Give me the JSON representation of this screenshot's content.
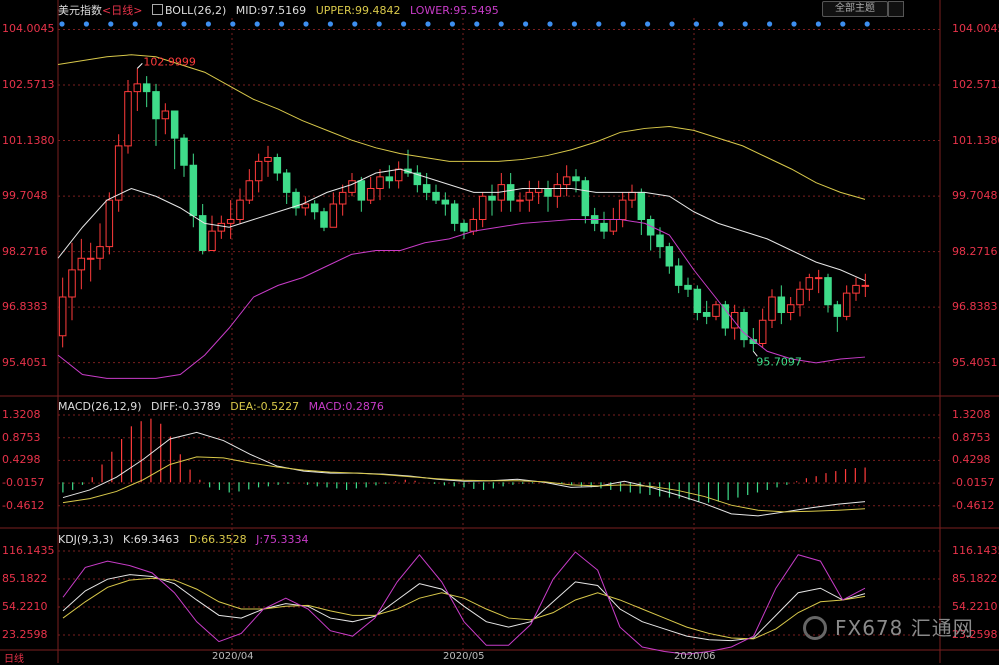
{
  "header": {
    "main": {
      "symbol": "美元指数",
      "period": "<日线>",
      "indicator": "BOLL(26,2)",
      "mid": "MID:97.5169",
      "upper": "UPPER:99.4842",
      "lower": "LOWER:95.5495"
    },
    "macd": {
      "name": "MACD(26,12,9)",
      "diff": "DIFF:-0.3789",
      "dea": "DEA:-0.5227",
      "macd": "MACD:0.2876"
    },
    "kdj": {
      "name": "KDJ(9,3,3)",
      "k": "K:69.3463",
      "d": "D:66.3528",
      "j": "J:75.3334"
    },
    "theme_button": "全部主题"
  },
  "colors": {
    "up": "#ff3b3b",
    "down": "#3fdc8a",
    "upper": "#d8c84a",
    "mid": "#e6e6e6",
    "lower": "#c83cc8",
    "dea": "#d8c84a",
    "diff": "#e6e6e6",
    "j": "#c83cc8",
    "grid": "#7a1f1f",
    "axis": "#e8334a"
  },
  "corner_label": "日线",
  "watermark": "FX678 汇通网",
  "chart_data": [
    {
      "type": "candlestick",
      "title": "美元指数 <日线> BOLL(26,2)",
      "ylim": [
        94.7,
        104.3
      ],
      "yticks": [
        104.0045,
        102.5713,
        101.138,
        99.7048,
        98.2716,
        96.8383,
        95.4051
      ],
      "xticks": [
        "2020/04",
        "2020/05",
        "2020/06"
      ],
      "annotations": [
        {
          "text": "102.9999",
          "type": "high"
        },
        {
          "text": "95.7097",
          "type": "low"
        }
      ],
      "candles": [
        [
          96.1,
          97.1,
          95.8,
          97.6
        ],
        [
          97.1,
          97.8,
          96.5,
          98.5
        ],
        [
          97.8,
          98.1,
          97.3,
          98.6
        ],
        [
          98.1,
          98.1,
          97.5,
          98.5
        ],
        [
          98.1,
          98.4,
          97.8,
          99.0
        ],
        [
          98.4,
          99.6,
          98.2,
          99.8
        ],
        [
          99.6,
          101.0,
          99.3,
          101.3
        ],
        [
          101.0,
          102.4,
          100.8,
          102.7
        ],
        [
          102.4,
          102.6,
          101.9,
          103.0
        ],
        [
          102.6,
          102.4,
          102.0,
          102.8
        ],
        [
          102.4,
          101.7,
          101.0,
          102.6
        ],
        [
          101.7,
          101.9,
          101.3,
          102.1
        ],
        [
          101.9,
          101.2,
          100.4,
          101.9
        ],
        [
          101.2,
          100.5,
          100.2,
          101.3
        ],
        [
          100.5,
          99.2,
          98.9,
          100.8
        ],
        [
          99.2,
          98.3,
          98.2,
          99.5
        ],
        [
          98.3,
          98.8,
          98.3,
          99.2
        ],
        [
          98.8,
          99.0,
          98.6,
          99.2
        ],
        [
          99.0,
          99.1,
          98.6,
          99.6
        ],
        [
          99.1,
          99.6,
          99.0,
          99.9
        ],
        [
          99.6,
          100.1,
          99.5,
          100.4
        ],
        [
          100.1,
          100.6,
          99.8,
          100.8
        ],
        [
          100.6,
          100.7,
          100.2,
          101.0
        ],
        [
          100.7,
          100.3,
          100.1,
          100.8
        ],
        [
          100.3,
          99.8,
          99.5,
          100.4
        ],
        [
          99.8,
          99.4,
          99.2,
          99.9
        ],
        [
          99.4,
          99.5,
          99.2,
          99.7
        ],
        [
          99.5,
          99.3,
          99.1,
          99.6
        ],
        [
          99.3,
          98.9,
          98.8,
          99.4
        ],
        [
          98.9,
          99.5,
          98.9,
          99.8
        ],
        [
          99.5,
          99.8,
          99.2,
          100.0
        ],
        [
          99.8,
          100.1,
          99.7,
          100.3
        ],
        [
          100.1,
          99.6,
          99.3,
          100.2
        ],
        [
          99.6,
          99.9,
          99.5,
          100.2
        ],
        [
          99.9,
          100.2,
          99.6,
          100.4
        ],
        [
          100.2,
          100.1,
          99.9,
          100.5
        ],
        [
          100.1,
          100.4,
          99.9,
          100.6
        ],
        [
          100.4,
          100.3,
          100.2,
          100.9
        ],
        [
          100.3,
          100.0,
          99.8,
          100.5
        ],
        [
          100.0,
          99.8,
          99.6,
          100.3
        ],
        [
          99.8,
          99.6,
          99.5,
          100.0
        ],
        [
          99.6,
          99.5,
          99.2,
          99.8
        ],
        [
          99.5,
          99.0,
          98.8,
          99.6
        ],
        [
          99.0,
          98.8,
          98.6,
          99.1
        ],
        [
          98.8,
          99.1,
          98.7,
          99.4
        ],
        [
          99.1,
          99.7,
          98.9,
          99.8
        ],
        [
          99.7,
          99.6,
          99.2,
          100.0
        ],
        [
          99.6,
          100.0,
          99.3,
          100.3
        ],
        [
          100.0,
          99.6,
          99.3,
          100.3
        ],
        [
          99.6,
          99.6,
          99.3,
          99.8
        ],
        [
          99.6,
          99.8,
          99.3,
          100.1
        ],
        [
          99.8,
          99.9,
          99.5,
          100.1
        ],
        [
          99.9,
          99.7,
          99.3,
          100.1
        ],
        [
          99.7,
          100.0,
          99.4,
          100.3
        ],
        [
          100.0,
          100.2,
          99.7,
          100.5
        ],
        [
          100.2,
          100.1,
          99.8,
          100.4
        ],
        [
          100.1,
          99.2,
          99.0,
          100.2
        ],
        [
          99.2,
          99.0,
          98.8,
          99.4
        ],
        [
          99.0,
          98.8,
          98.6,
          99.3
        ],
        [
          98.8,
          99.1,
          98.7,
          99.4
        ],
        [
          99.1,
          99.6,
          98.9,
          99.8
        ],
        [
          99.6,
          99.8,
          99.4,
          100.0
        ],
        [
          99.8,
          99.1,
          98.7,
          99.9
        ],
        [
          99.1,
          98.7,
          98.3,
          99.2
        ],
        [
          98.7,
          98.4,
          98.1,
          98.9
        ],
        [
          98.4,
          97.9,
          97.7,
          98.5
        ],
        [
          97.9,
          97.4,
          97.2,
          98.1
        ],
        [
          97.4,
          97.3,
          97.1,
          97.6
        ],
        [
          97.3,
          96.7,
          96.5,
          97.4
        ],
        [
          96.7,
          96.6,
          96.4,
          97.0
        ],
        [
          96.6,
          96.9,
          96.5,
          97.0
        ],
        [
          96.9,
          96.3,
          96.1,
          97.0
        ],
        [
          96.3,
          96.7,
          96.0,
          96.9
        ],
        [
          96.7,
          96.0,
          95.8,
          96.8
        ],
        [
          96.0,
          95.9,
          95.7,
          96.3
        ],
        [
          95.9,
          96.5,
          95.8,
          96.8
        ],
        [
          96.5,
          97.1,
          96.3,
          97.3
        ],
        [
          97.1,
          96.7,
          96.4,
          97.4
        ],
        [
          96.7,
          96.9,
          96.5,
          97.1
        ],
        [
          96.9,
          97.3,
          96.6,
          97.5
        ],
        [
          97.3,
          97.6,
          97.0,
          97.7
        ],
        [
          97.6,
          97.6,
          97.2,
          97.8
        ],
        [
          97.6,
          96.9,
          96.7,
          97.7
        ],
        [
          96.9,
          96.6,
          96.2,
          97.0
        ],
        [
          96.6,
          97.2,
          96.5,
          97.4
        ],
        [
          97.2,
          97.4,
          97.0,
          97.6
        ],
        [
          97.4,
          97.4,
          97.1,
          97.7
        ]
      ],
      "series": [
        {
          "name": "UPPER",
          "values": [
            103.1,
            103.2,
            103.3,
            103.35,
            103.3,
            103.1,
            102.9,
            102.55,
            102.2,
            101.95,
            101.65,
            101.4,
            101.15,
            100.95,
            100.8,
            100.7,
            100.6,
            100.6,
            100.6,
            100.65,
            100.75,
            100.9,
            101.1,
            101.35,
            101.45,
            101.5,
            101.4,
            101.2,
            101.0,
            100.7,
            100.4,
            100.05,
            99.8,
            99.62
          ]
        },
        {
          "name": "MID",
          "values": [
            98.1,
            98.9,
            99.6,
            99.9,
            99.7,
            99.4,
            99.0,
            98.9,
            99.1,
            99.3,
            99.5,
            99.8,
            100.0,
            100.3,
            100.4,
            100.2,
            100.0,
            99.8,
            99.8,
            99.9,
            99.9,
            99.9,
            99.8,
            99.8,
            99.8,
            99.7,
            99.3,
            99.0,
            98.8,
            98.6,
            98.3,
            98.0,
            97.8,
            97.52
          ]
        },
        {
          "name": "LOWER",
          "values": [
            95.6,
            95.1,
            95.0,
            95.0,
            95.0,
            95.1,
            95.6,
            96.3,
            97.1,
            97.4,
            97.6,
            97.9,
            98.2,
            98.3,
            98.3,
            98.5,
            98.6,
            98.8,
            98.9,
            99.0,
            99.05,
            99.1,
            99.1,
            99.1,
            99.0,
            98.7,
            97.8,
            97.0,
            96.2,
            95.7,
            95.5,
            95.4,
            95.5,
            95.55
          ]
        }
      ]
    },
    {
      "type": "bar",
      "title": "MACD(26,12,9)",
      "ylim": [
        -0.78,
        1.42
      ],
      "yticks": [
        1.3208,
        0.8753,
        0.4298,
        -0.0157,
        -0.4612
      ],
      "series": [
        {
          "name": "MACD",
          "values": [
            -0.2,
            -0.15,
            -0.05,
            0.1,
            0.35,
            0.6,
            0.85,
            1.1,
            1.2,
            1.25,
            1.15,
            0.9,
            0.55,
            0.25,
            0.05,
            -0.1,
            -0.15,
            -0.2,
            -0.18,
            -0.14,
            -0.1,
            -0.08,
            -0.05,
            -0.03,
            0.0,
            -0.05,
            -0.08,
            -0.1,
            -0.12,
            -0.15,
            -0.12,
            -0.1,
            -0.06,
            -0.03,
            0.02,
            0.05,
            0.03,
            0.0,
            -0.03,
            -0.06,
            -0.08,
            -0.1,
            -0.13,
            -0.15,
            -0.12,
            -0.08,
            -0.05,
            -0.03,
            -0.02,
            -0.01,
            0.0,
            -0.03,
            -0.06,
            -0.08,
            -0.1,
            -0.12,
            -0.15,
            -0.18,
            -0.2,
            -0.22,
            -0.25,
            -0.28,
            -0.3,
            -0.32,
            -0.35,
            -0.38,
            -0.4,
            -0.38,
            -0.35,
            -0.3,
            -0.25,
            -0.2,
            -0.15,
            -0.1,
            -0.05,
            0.02,
            0.08,
            0.12,
            0.18,
            0.22,
            0.26,
            0.28,
            0.29
          ]
        },
        {
          "name": "DIFF",
          "values": [
            -0.3,
            -0.15,
            0.1,
            0.45,
            0.85,
            0.98,
            0.82,
            0.55,
            0.32,
            0.22,
            0.18,
            0.18,
            0.16,
            0.12,
            0.06,
            0.02,
            0.03,
            0.06,
            0.0,
            -0.1,
            -0.08,
            0.02,
            -0.1,
            -0.25,
            -0.42,
            -0.62,
            -0.66,
            -0.58,
            -0.5,
            -0.43,
            -0.38
          ]
        },
        {
          "name": "DEA",
          "values": [
            -0.4,
            -0.32,
            -0.18,
            0.05,
            0.35,
            0.5,
            0.48,
            0.38,
            0.3,
            0.24,
            0.2,
            0.18,
            0.15,
            0.11,
            0.07,
            0.04,
            0.03,
            0.03,
            0.01,
            -0.05,
            -0.07,
            -0.05,
            -0.08,
            -0.16,
            -0.28,
            -0.45,
            -0.55,
            -0.58,
            -0.57,
            -0.55,
            -0.52
          ]
        }
      ]
    },
    {
      "type": "line",
      "title": "KDJ(9,3,3)",
      "ylim": [
        10,
        125
      ],
      "yticks": [
        116.1435,
        85.1822,
        54.221,
        23.2598
      ],
      "series": [
        {
          "name": "K",
          "values": [
            50,
            72,
            85,
            90,
            88,
            80,
            62,
            45,
            42,
            52,
            58,
            55,
            42,
            38,
            44,
            62,
            80,
            74,
            55,
            38,
            32,
            38,
            60,
            82,
            78,
            52,
            38,
            30,
            22,
            18,
            17,
            20,
            45,
            70,
            75,
            62,
            69
          ]
        },
        {
          "name": "D",
          "values": [
            42,
            60,
            76,
            84,
            86,
            84,
            74,
            60,
            52,
            52,
            55,
            56,
            50,
            45,
            45,
            52,
            64,
            70,
            64,
            52,
            42,
            40,
            48,
            62,
            70,
            62,
            52,
            42,
            32,
            25,
            20,
            19,
            30,
            48,
            60,
            62,
            66
          ]
        },
        {
          "name": "J",
          "values": [
            65,
            98,
            105,
            100,
            92,
            70,
            38,
            16,
            25,
            52,
            64,
            52,
            28,
            22,
            42,
            82,
            112,
            82,
            38,
            12,
            12,
            35,
            85,
            115,
            95,
            32,
            10,
            5,
            2,
            5,
            10,
            22,
            75,
            112,
            105,
            62,
            75
          ]
        }
      ]
    }
  ]
}
